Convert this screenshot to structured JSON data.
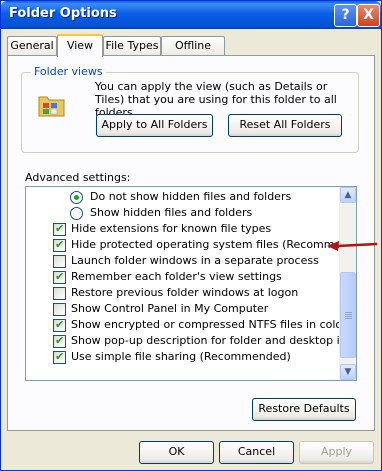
{
  "window": {
    "title": "Folder Options",
    "help_glyph": "?",
    "close_glyph": "X"
  },
  "tabs": [
    {
      "label": "General"
    },
    {
      "label": "View"
    },
    {
      "label": "File Types"
    },
    {
      "label": "Offline Files"
    }
  ],
  "folder_views": {
    "heading": "Folder views",
    "description": "You can apply the view (such as Details or Tiles) that you are using for this folder to all folders.",
    "apply_label": "Apply to All Folders",
    "reset_label": "Reset All Folders"
  },
  "advanced": {
    "heading": "Advanced settings:",
    "items": [
      {
        "type": "radio",
        "label": "Do not show hidden files and folders",
        "selected": true
      },
      {
        "type": "radio",
        "label": "Show hidden files and folders",
        "selected": false
      },
      {
        "type": "checkbox",
        "label": "Hide extensions for known file types",
        "checked": true
      },
      {
        "type": "checkbox",
        "label": "Hide protected operating system files (Recommended)",
        "checked": true
      },
      {
        "type": "checkbox",
        "label": "Launch folder windows in a separate process",
        "checked": false
      },
      {
        "type": "checkbox",
        "label": "Remember each folder's view settings",
        "checked": true
      },
      {
        "type": "checkbox",
        "label": "Restore previous folder windows at logon",
        "checked": false
      },
      {
        "type": "checkbox",
        "label": "Show Control Panel in My Computer",
        "checked": false
      },
      {
        "type": "checkbox",
        "label": "Show encrypted or compressed NTFS files in color",
        "checked": true
      },
      {
        "type": "checkbox",
        "label": "Show pop-up description for folder and desktop items",
        "checked": true
      },
      {
        "type": "checkbox",
        "label": "Use simple file sharing (Recommended)",
        "checked": true
      }
    ],
    "scroll_up_glyph": "▲",
    "scroll_down_glyph": "▼",
    "restore_label": "Restore Defaults"
  },
  "footer": {
    "ok_label": "OK",
    "cancel_label": "Cancel",
    "apply_label": "Apply"
  },
  "colors": {
    "annotation_arrow": "#b01414",
    "check": "#21a121"
  }
}
